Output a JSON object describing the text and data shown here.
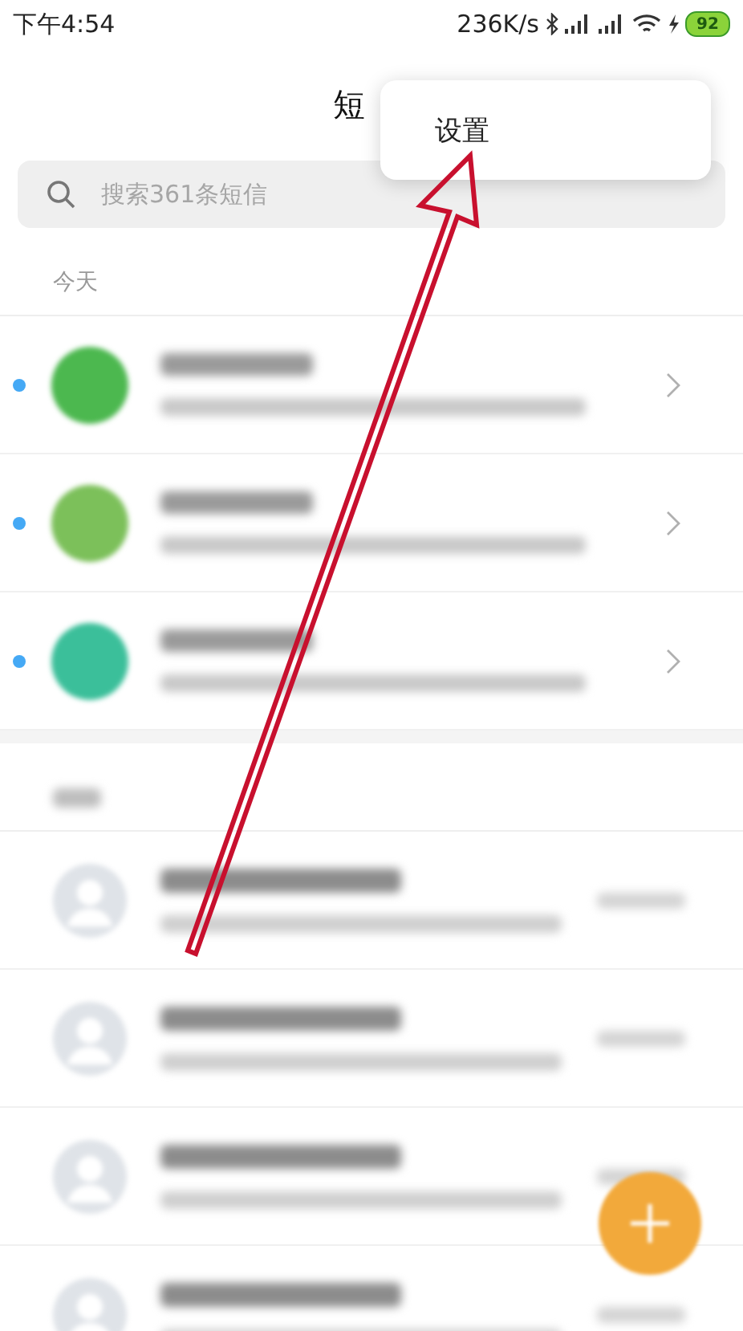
{
  "status_bar": {
    "time": "下午4:54",
    "speed": "236K/s",
    "battery": "92"
  },
  "header": {
    "title": "短"
  },
  "search": {
    "placeholder": "搜索361条短信"
  },
  "sections": [
    {
      "label": "今天",
      "rows": [
        {
          "kind": "notice",
          "unread": true,
          "color": "#4cb84f"
        },
        {
          "kind": "notice",
          "unread": true,
          "color": "#7cc05a"
        },
        {
          "kind": "notice",
          "unread": true,
          "color": "#3bbf9a"
        }
      ]
    },
    {
      "rows": [
        {
          "kind": "contact",
          "unread": false
        },
        {
          "kind": "contact",
          "unread": false
        },
        {
          "kind": "contact",
          "unread": false
        },
        {
          "kind": "contact",
          "unread": false
        }
      ]
    }
  ],
  "menu": {
    "items": [
      "设置"
    ]
  }
}
